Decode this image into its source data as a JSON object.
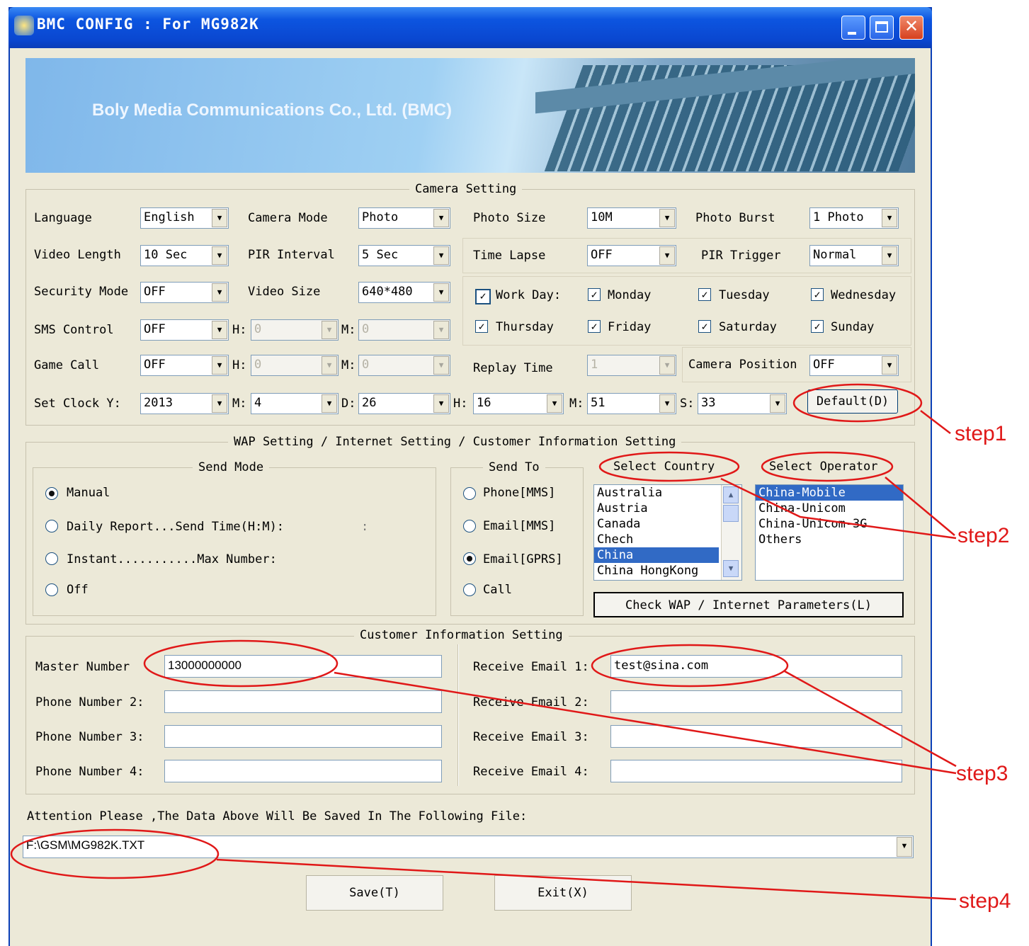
{
  "window": {
    "title": "BMC CONFIG : For MG982K"
  },
  "banner": {
    "text": "Boly Media Communications Co., Ltd. (BMC)"
  },
  "camera_setting": {
    "legend": "Camera Setting",
    "language": {
      "label": "Language",
      "value": "English"
    },
    "camera_mode": {
      "label": "Camera Mode",
      "value": "Photo"
    },
    "photo_size": {
      "label": "Photo Size",
      "value": "10M"
    },
    "photo_burst": {
      "label": "Photo Burst",
      "value": "1 Photo"
    },
    "video_length": {
      "label": "Video Length",
      "value": "10  Sec"
    },
    "pir_interval": {
      "label": "PIR Interval",
      "value": "5  Sec"
    },
    "time_lapse": {
      "label": "Time Lapse",
      "value": "OFF"
    },
    "pir_trigger": {
      "label": "PIR Trigger",
      "value": "Normal"
    },
    "security_mode": {
      "label": "Security Mode",
      "value": "OFF"
    },
    "video_size": {
      "label": "Video Size",
      "value": "640*480"
    },
    "work_day": {
      "label": "Work Day:",
      "checked": true
    },
    "days": [
      {
        "label": "Monday",
        "checked": true
      },
      {
        "label": "Tuesday",
        "checked": true
      },
      {
        "label": "Wednesday",
        "checked": true
      },
      {
        "label": "Thursday",
        "checked": true
      },
      {
        "label": "Friday",
        "checked": true
      },
      {
        "label": "Saturday",
        "checked": true
      },
      {
        "label": "Sunday",
        "checked": true
      }
    ],
    "sms_control": {
      "label": "SMS Control",
      "value": "OFF",
      "h_label": "H:",
      "h_value": "0",
      "m_label": "M:",
      "m_value": "0"
    },
    "game_call": {
      "label": "Game Call",
      "value": "OFF",
      "h_label": "H:",
      "h_value": "0",
      "m_label": "M:",
      "m_value": "0"
    },
    "replay_time": {
      "label": "Replay Time",
      "value": "1"
    },
    "camera_position": {
      "label": "Camera Position",
      "value": "OFF"
    },
    "set_clock": {
      "label": "Set Clock Y:",
      "y": "2013",
      "m_label": "M:",
      "m": "4",
      "d_label": "D:",
      "d": "26",
      "h_label": "H:",
      "h": "16",
      "mi_label": "M:",
      "mi": "51",
      "s_label": "S:",
      "s": "33"
    },
    "default_button": "Default(D)"
  },
  "wap_setting": {
    "legend": "WAP Setting / Internet Setting / Customer Information Setting",
    "send_mode": {
      "legend": "Send Mode",
      "options": [
        {
          "label": "Manual",
          "selected": true
        },
        {
          "label": "Daily Report...Send Time(H:M):",
          "selected": false
        },
        {
          "label": "Instant...........Max Number:",
          "selected": false
        },
        {
          "label": "Off",
          "selected": false
        }
      ],
      "time_separator": ":"
    },
    "send_to": {
      "legend": "Send To",
      "options": [
        {
          "label": "Phone[MMS]",
          "selected": false
        },
        {
          "label": "Email[MMS]",
          "selected": false
        },
        {
          "label": "Email[GPRS]",
          "selected": true
        },
        {
          "label": "Call",
          "selected": false
        }
      ]
    },
    "select_country": {
      "label": "Select Country",
      "items": [
        "Australia",
        "Austria",
        "Canada",
        "Chech",
        "China",
        "China HongKong"
      ],
      "selected": "China"
    },
    "select_operator": {
      "label": "Select Operator",
      "items": [
        "China-Mobile",
        "China-Unicom",
        "China-Unicom-3G",
        "Others"
      ],
      "selected": "China-Mobile"
    },
    "check_button": "Check WAP / Internet Parameters(L)"
  },
  "customer_info": {
    "legend": "Customer Information Setting",
    "phones": [
      {
        "label": "Master Number",
        "value": "13000000000"
      },
      {
        "label": "Phone Number 2:",
        "value": ""
      },
      {
        "label": "Phone Number 3:",
        "value": ""
      },
      {
        "label": "Phone Number 4:",
        "value": ""
      }
    ],
    "emails": [
      {
        "label": "Receive Email 1:",
        "value": "test@sina.com"
      },
      {
        "label": "Receive Email 2:",
        "value": ""
      },
      {
        "label": "Receive Email 3:",
        "value": ""
      },
      {
        "label": "Receive Email 4:",
        "value": ""
      }
    ]
  },
  "footer": {
    "attention": "Attention Please ,The Data Above Will Be Saved In The Following  File:",
    "file_path": "F:\\GSM\\MG982K.TXT",
    "save_button": "Save(T)",
    "exit_button": "Exit(X)"
  },
  "annotations": {
    "step1": "step1",
    "step2": "step2",
    "step3": "step3",
    "step4": "step4",
    "color": "#e01818"
  }
}
